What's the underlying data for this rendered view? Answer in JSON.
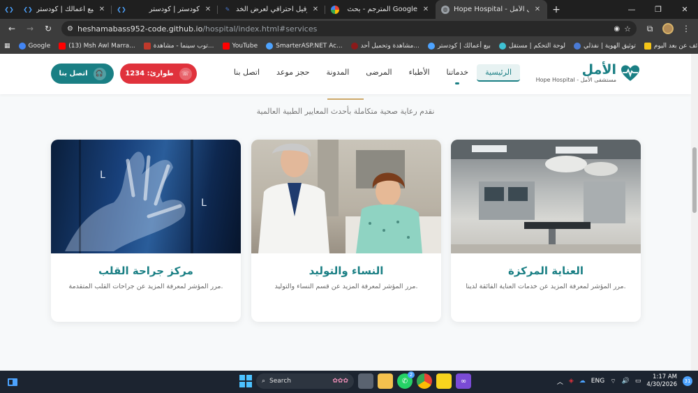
{
  "browser": {
    "tabs": [
      {
        "title": "بيع أعمالك | كودستر",
        "active": false
      },
      {
        "title": "كودستر | كودستر",
        "active": false
      },
      {
        "title": "انشاء بروفيل احترافي لعرض الخد...",
        "active": false
      },
      {
        "title": "المترجم - بحث Google",
        "active": false
      },
      {
        "title": "Hope Hospital - مستشفى الأمل",
        "active": true
      }
    ],
    "new_tab": "+",
    "url_host": "heshamabass952-code.github.io",
    "url_path": "/hospital/index.html#services",
    "bookmarks": [
      {
        "label": "Google",
        "color": "#4285f4"
      },
      {
        "label": "(13) Msh Awl Marra...",
        "color": "#ff0000"
      },
      {
        "label": "توب سينما - مشاهدة...",
        "color": "#c0392b"
      },
      {
        "label": "YouTube",
        "color": "#ff0000"
      },
      {
        "label": "SmarterASP.NET Ac...",
        "color": "#4da3ff"
      },
      {
        "label": "مشاهدة وتحميل أحد...",
        "color": "#8b1a1a"
      },
      {
        "label": "بيع أعمالك | كودستر",
        "color": "#4da3ff"
      },
      {
        "label": "لوحة التحكم | مستقل",
        "color": "#3ec1d3"
      },
      {
        "label": "توثيق الهوية | نفذلي",
        "color": "#4a7bd6"
      },
      {
        "label": "وظائف عن بعد اليوم...",
        "color": "#f5c518"
      }
    ]
  },
  "site": {
    "logo_title": "الأمل",
    "logo_subtitle": "مستشفى الأمل - Hope Hospital",
    "nav": [
      "الرئيسية",
      "خدماتنا",
      "الأطباء",
      "المرضى",
      "المدونة",
      "حجز موعد",
      "اتصل بنا"
    ],
    "emergency_label": "طوارئ: 1234",
    "contact_label": "اتصل بنا",
    "section_subtitle": "نقدم رعاية صحية متكاملة بأحدث المعايير الطبية العالمية",
    "cards": [
      {
        "title": "مركز جراحة القلب",
        "desc": "مرر المؤشر لمعرفة المزيد عن جراحات القلب المتقدمة."
      },
      {
        "title": "النساء والتوليد",
        "desc": "مرر المؤشر لمعرفة المزيد عن قسم النساء والتوليد."
      },
      {
        "title": "العناية المركزة",
        "desc": "مرر المؤشر لمعرفة المزيد عن خدمات العناية الفائقة لدينا."
      }
    ]
  },
  "taskbar": {
    "search_label": "Search",
    "lang": "ENG",
    "time": "1:17 AM",
    "date": "4/30/2026",
    "whatsapp_badge": "2",
    "notif_count": "31"
  },
  "colors": {
    "teal": "#1a7f84",
    "red": "#e0323c",
    "gold": "#cda869"
  }
}
